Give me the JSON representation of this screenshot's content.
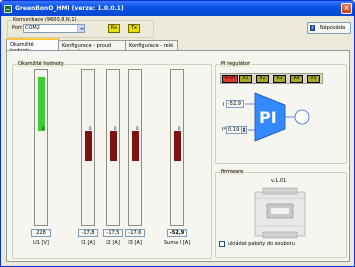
{
  "window": {
    "title": "GreenBonO_HMI (verze: 1.0.0.1)",
    "close": "×"
  },
  "comm": {
    "group_title": "Komunikace (9600,8,N,1)",
    "port_label": "Port",
    "port_value": "COM2",
    "rx_label": "Rx",
    "tx_label": "Tx"
  },
  "help_label": "Nápověda",
  "tabs": [
    "Okamžité hodnoty",
    "Konfigurace - proud snímače",
    "Konfigurace - relé"
  ],
  "values": {
    "group_title": "Okamžité hodnoty",
    "channels": [
      {
        "label": "U1 [V]",
        "value": "228",
        "top": "0",
        "level": 0.9,
        "color": "#3ccd32"
      },
      {
        "label": "I1 [A]",
        "value": "-17,8",
        "top": "0",
        "level": -0.5,
        "color": "#7d1213"
      },
      {
        "label": "I2 [A]",
        "value": "-17,5",
        "top": "0",
        "level": -0.5,
        "color": "#7d1213"
      },
      {
        "label": "I3 [A]",
        "value": "-17,6",
        "top": "0",
        "level": -0.5,
        "color": "#7d1213"
      },
      {
        "label": "Suma I [A]",
        "value": "-52,9",
        "top": "0",
        "level": -0.5,
        "color": "#7d1213"
      }
    ]
  },
  "pi": {
    "group_title": "PI regulátor",
    "outputs": [
      {
        "label": "R-off",
        "color": "#e03a2c"
      },
      {
        "label": "R1",
        "color": "#a6a62a"
      },
      {
        "label": "R2",
        "color": "#a6a62a"
      },
      {
        "label": "R3",
        "color": "#a6a62a"
      },
      {
        "label": "R4",
        "color": "#a6a62a"
      },
      {
        "label": "R5",
        "color": "#a6a62a"
      }
    ],
    "i_label": "I",
    "i_value": "-52,9",
    "iref_label": "I*",
    "iref_value": "0,19",
    "block_label": "PI"
  },
  "fw": {
    "group_title": "firmware",
    "version": "v.1.01",
    "save_label": "ukládat pakety do souboru",
    "save_checked": false
  },
  "colors": {
    "accent": "#3389ff",
    "titlebar": "#0a52e6",
    "led_bg": "#d8d8c8"
  }
}
